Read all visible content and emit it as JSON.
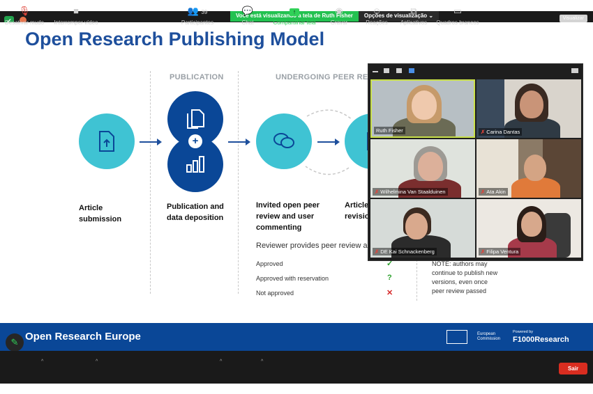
{
  "share_banner": {
    "viewing_text": "Você está visualizando a tela de Ruth Fisher",
    "options_label": "Opções de visualização",
    "options_caret": "⌄"
  },
  "view_button": "Visualizar",
  "slide": {
    "title": "Open Research Publishing Model",
    "col_publication": "PUBLICATION",
    "col_peer_review": "UNDERGOING PEER REVIE",
    "steps": [
      {
        "line1": "Article",
        "line2": "submission"
      },
      {
        "line1": "Publication and",
        "line2": "data deposition"
      },
      {
        "line1": "Invited open peer",
        "line2": "review and user",
        "line3": "commenting"
      },
      {
        "line1": "Article",
        "line2": "revisio"
      }
    ],
    "reviewer_text": "Reviewer provides peer review an",
    "statuses": [
      {
        "label": "Approved",
        "mark": "✓",
        "color": "#2ca02c"
      },
      {
        "label": "Approved with reservation",
        "mark": "?",
        "color": "#2ca02c"
      },
      {
        "label": "Not approved",
        "mark": "✕",
        "color": "#d62728"
      }
    ],
    "note_lines": [
      "NOTE: authors may",
      "continue to publish new",
      "versions, even once",
      "peer review passed"
    ],
    "plus_sign": "+"
  },
  "participants": [
    {
      "name": "Ruth Fisher",
      "muted": false
    },
    {
      "name": "Carina Dantas",
      "muted": true
    },
    {
      "name": "Wilhelmina Van Staalduinen",
      "muted": true
    },
    {
      "name": "Ata Akin",
      "muted": true
    },
    {
      "name": "DE Kai Schnackenberg",
      "muted": true
    },
    {
      "name": "Filipa Ventura",
      "muted": true
    }
  ],
  "footer": {
    "title": "Open Research Europe",
    "ec_line1": "European",
    "ec_line2": "Commission",
    "powered_by": "Powered by",
    "f1000": "F1000Research"
  },
  "toolbar": {
    "mute": "Desativar mudo",
    "video": "Interromper vídeo",
    "participants": "Participantes",
    "participants_count": "39",
    "chat": "Chat",
    "share": "Compartilhar tela",
    "record": "Gravar",
    "reactions": "Reações",
    "apps": "Aplicativos",
    "whiteboards": "Quadros brancos",
    "exit": "Sair"
  },
  "colors": {
    "brand_navy": "#0a4797",
    "teal": "#3fc3d3",
    "share_green": "#23c150",
    "exit_red": "#d92d20"
  }
}
